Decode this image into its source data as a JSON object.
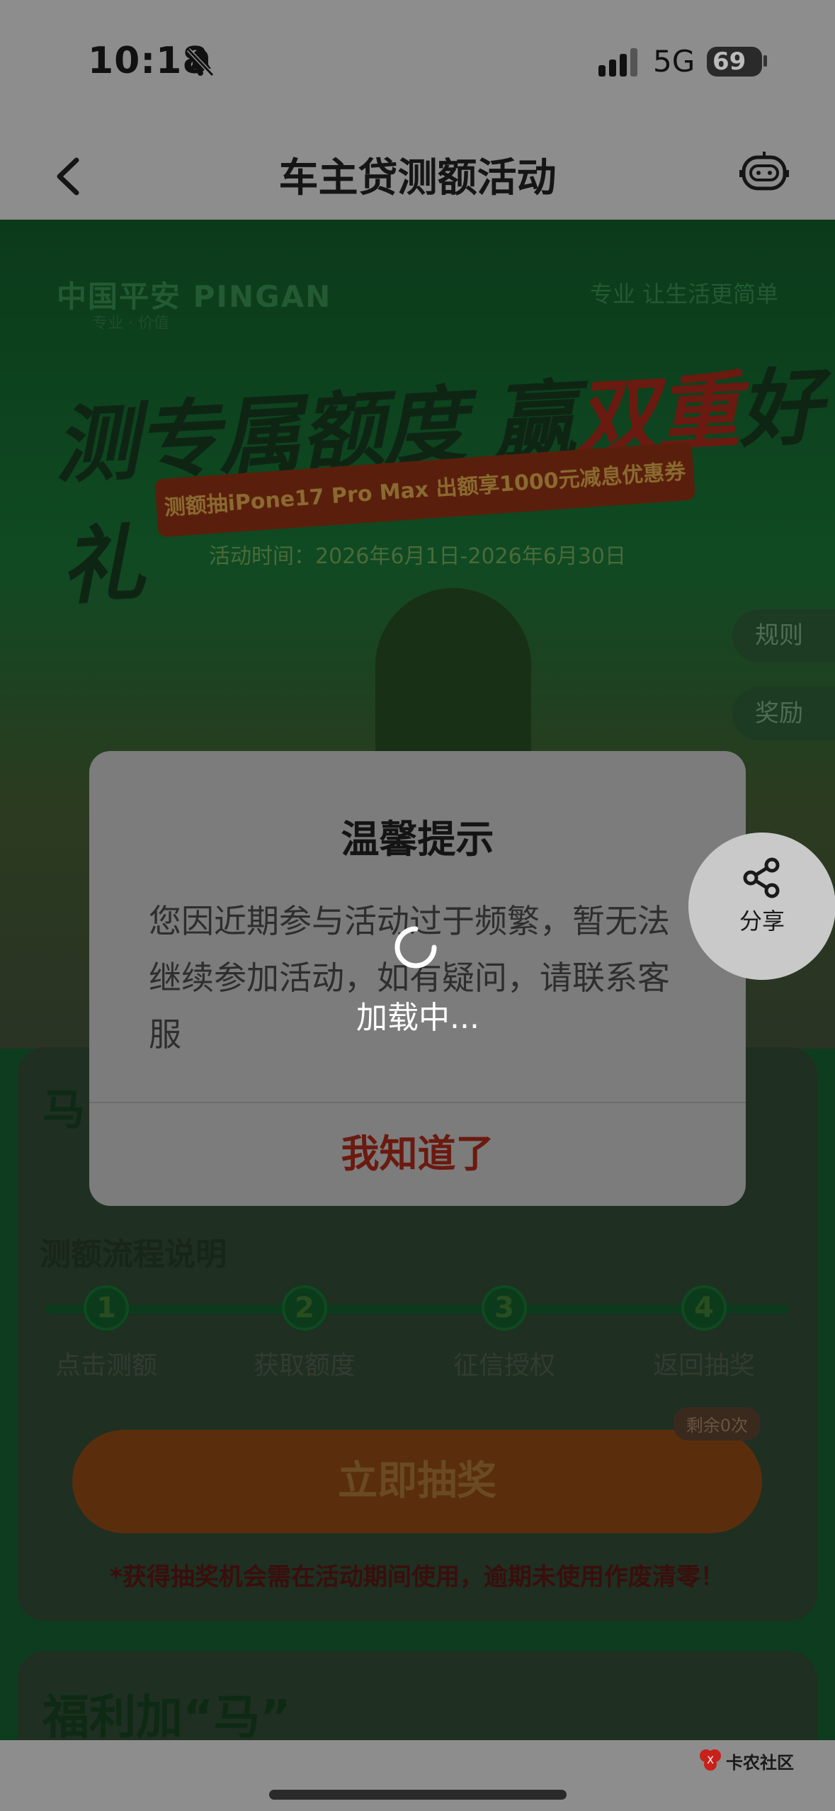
{
  "status_bar": {
    "time": "10:18",
    "network": "5G",
    "battery": "69"
  },
  "nav": {
    "title": "车主贷测额活动"
  },
  "hero": {
    "brand": "中国平安 PINGAN",
    "brand_sub": "专业 · 价值",
    "slogan": "专业 让生活更简单",
    "headline_part1": "测专属额度 赢",
    "headline_part2": "双重",
    "headline_part3": "好礼",
    "ribbon": "测额抽iPone17 Pro Max  出额享1000元减息优惠券",
    "activity_time": "活动时间：2026年6月1日-2026年6月30日"
  },
  "side_tabs": {
    "rules": "规则",
    "prizes": "奖励"
  },
  "card1": {
    "title": "马",
    "flow_title": "测额流程说明",
    "steps": [
      {
        "num": "1",
        "label": "点击测额"
      },
      {
        "num": "2",
        "label": "获取额度"
      },
      {
        "num": "3",
        "label": "征信授权"
      },
      {
        "num": "4",
        "label": "返回抽奖"
      }
    ],
    "remain": "剩余0次",
    "draw_button": "立即抽奖",
    "warning": "*获得抽奖机会需在活动期间使用，逾期未使用作废清零！"
  },
  "card2": {
    "title": "福利加“马”"
  },
  "dialog": {
    "title": "温馨提示",
    "body": "您因近期参与活动过于频繁，暂无法继续参加活动，如有疑问，请联系客服",
    "button": "我知道了"
  },
  "share": {
    "label": "分享"
  },
  "loading": {
    "text": "加载中..."
  },
  "watermark": {
    "text": "卡农社区"
  },
  "colors": {
    "accent_red": "#c9341a",
    "dialog_bg": "#7c7c7c",
    "page_green": "#0d3d1e"
  }
}
